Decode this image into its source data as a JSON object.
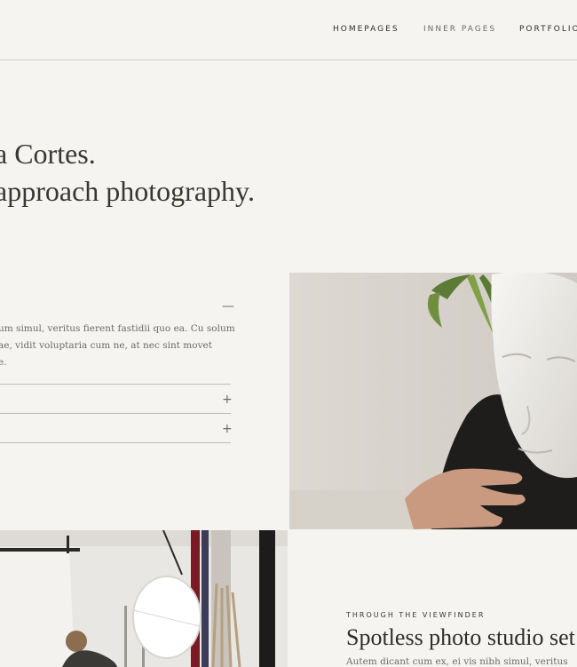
{
  "nav": {
    "items": [
      {
        "label": "HOMEPAGES"
      },
      {
        "label": "INNER PAGES"
      },
      {
        "label": "PORTFOLIO"
      }
    ]
  },
  "hero": {
    "line1": "a Cortes.",
    "line2": "approach photography."
  },
  "accordion": {
    "open_toggle": "—",
    "body_lines": [
      "um simul, veritus fierent fastidii quo ea. Cu solum",
      "ae, vidit voluptaria cum ne, at nec sint movet",
      "e."
    ],
    "closed_toggle": "+"
  },
  "photos": {
    "statue": "sculpture-mask-photo",
    "studio": "photo-studio-umbrella-photo"
  },
  "card": {
    "eyebrow": "THROUGH THE VIEWFINDER",
    "title": "Spotless photo studio set",
    "text": "Autem dicant cum ex, ei vis nibh simul, veritus"
  },
  "colors": {
    "background": "#f5f4f1",
    "text": "#2f2d2a",
    "muted": "#6d6b66",
    "rule": "#bfbdb8"
  }
}
